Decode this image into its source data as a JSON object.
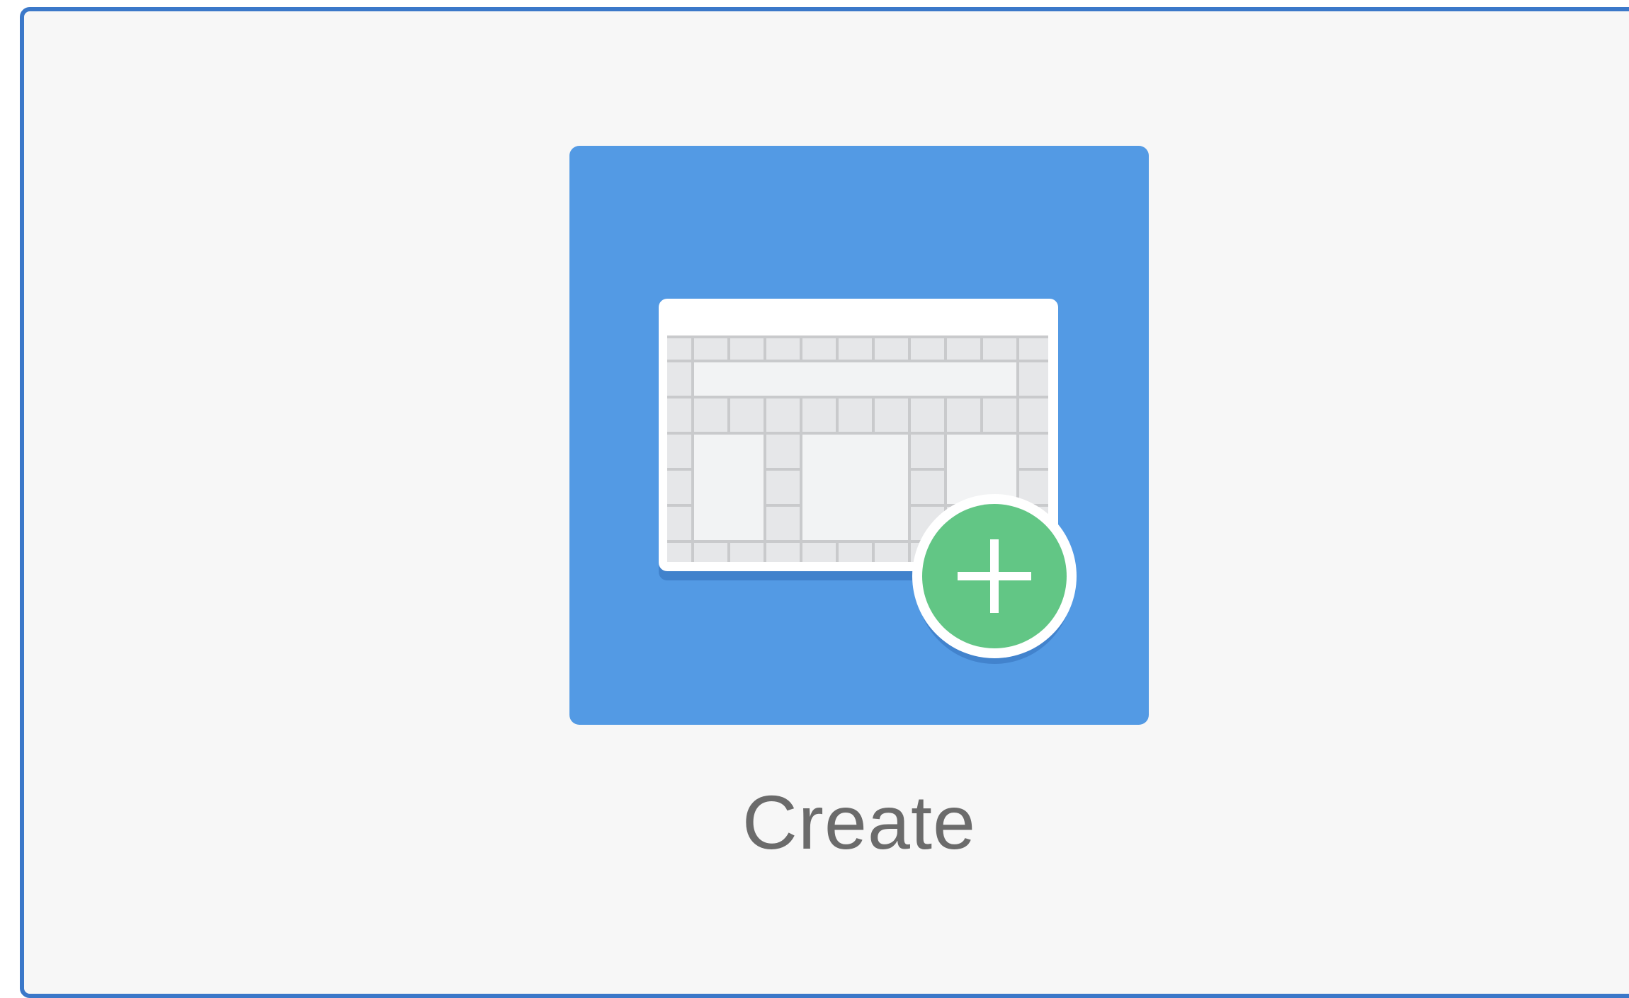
{
  "card": {
    "label": "Create",
    "icon": "table-with-add-icon"
  },
  "colors": {
    "card_border": "#3b78c9",
    "card_background": "#f7f7f7",
    "tile_background": "#539ae4",
    "add_badge": "#62c685",
    "label_text": "#6b6b6b"
  }
}
